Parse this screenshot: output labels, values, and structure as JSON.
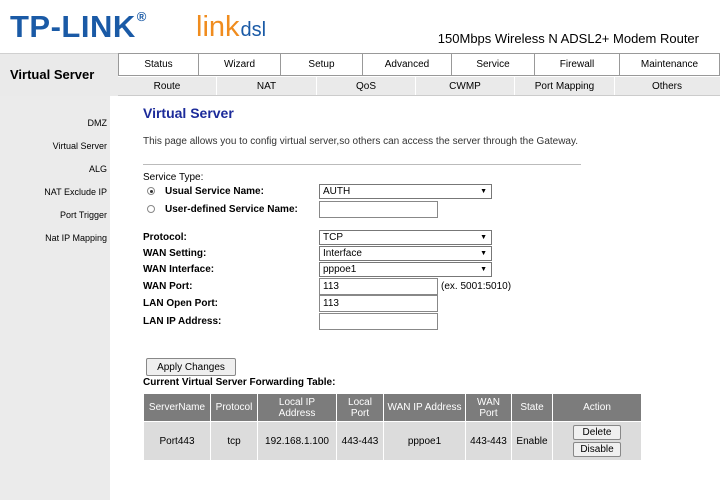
{
  "header": {
    "logo_tp": "TP-LINK",
    "logo_reg": "®",
    "logo_link": "link",
    "logo_dsl": "dsl",
    "model_title": "150Mbps Wireless N ADSL2+ Modem Router"
  },
  "section_label": "Virtual Server",
  "nav": {
    "row1": [
      "Status",
      "Wizard",
      "Setup",
      "Advanced",
      "Service",
      "Firewall",
      "Maintenance"
    ],
    "row2": [
      "Route",
      "NAT",
      "QoS",
      "CWMP",
      "Port Mapping",
      "Others"
    ]
  },
  "sidebar": {
    "items": [
      "DMZ",
      "Virtual Server",
      "ALG",
      "NAT Exclude IP",
      "Port Trigger",
      "Nat IP Mapping"
    ]
  },
  "page": {
    "title": "Virtual Server",
    "description": "This page allows you to config virtual server,so others can access the server through the Gateway."
  },
  "form": {
    "service_type_label": "Service Type:",
    "usual_service_label": "Usual Service Name:",
    "usual_service_value": "AUTH",
    "user_defined_label": "User-defined Service Name:",
    "user_defined_value": "",
    "protocol_label": "Protocol:",
    "protocol_value": "TCP",
    "wan_setting_label": "WAN Setting:",
    "wan_setting_value": "Interface",
    "wan_interface_label": "WAN Interface:",
    "wan_interface_value": "pppoe1",
    "wan_port_label": "WAN Port:",
    "wan_port_value": "113",
    "wan_port_hint": "(ex. 5001:5010)",
    "lan_open_port_label": "LAN Open Port:",
    "lan_open_port_value": "113",
    "lan_ip_label": "LAN IP Address:",
    "lan_ip_value": "",
    "apply_label": "Apply Changes"
  },
  "table": {
    "caption": "Current Virtual Server Forwarding Table:",
    "headers": [
      "ServerName",
      "Protocol",
      "Local IP Address",
      "Local Port",
      "WAN IP Address",
      "WAN Port",
      "State",
      "Action"
    ],
    "rows": [
      {
        "server_name": "Port443",
        "protocol": "tcp",
        "local_ip": "192.168.1.100",
        "local_port": "443-443",
        "wan_ip": "pppoe1",
        "wan_port": "443-443",
        "state": "Enable",
        "delete_label": "Delete",
        "disable_label": "Disable"
      }
    ]
  },
  "colors": {
    "title_blue": "#1c2b9a",
    "logo_blue": "#1a5aa6",
    "logo_orange": "#f08c1e",
    "table_header": "#7c7c7c",
    "table_cell": "#dcdcdc"
  }
}
